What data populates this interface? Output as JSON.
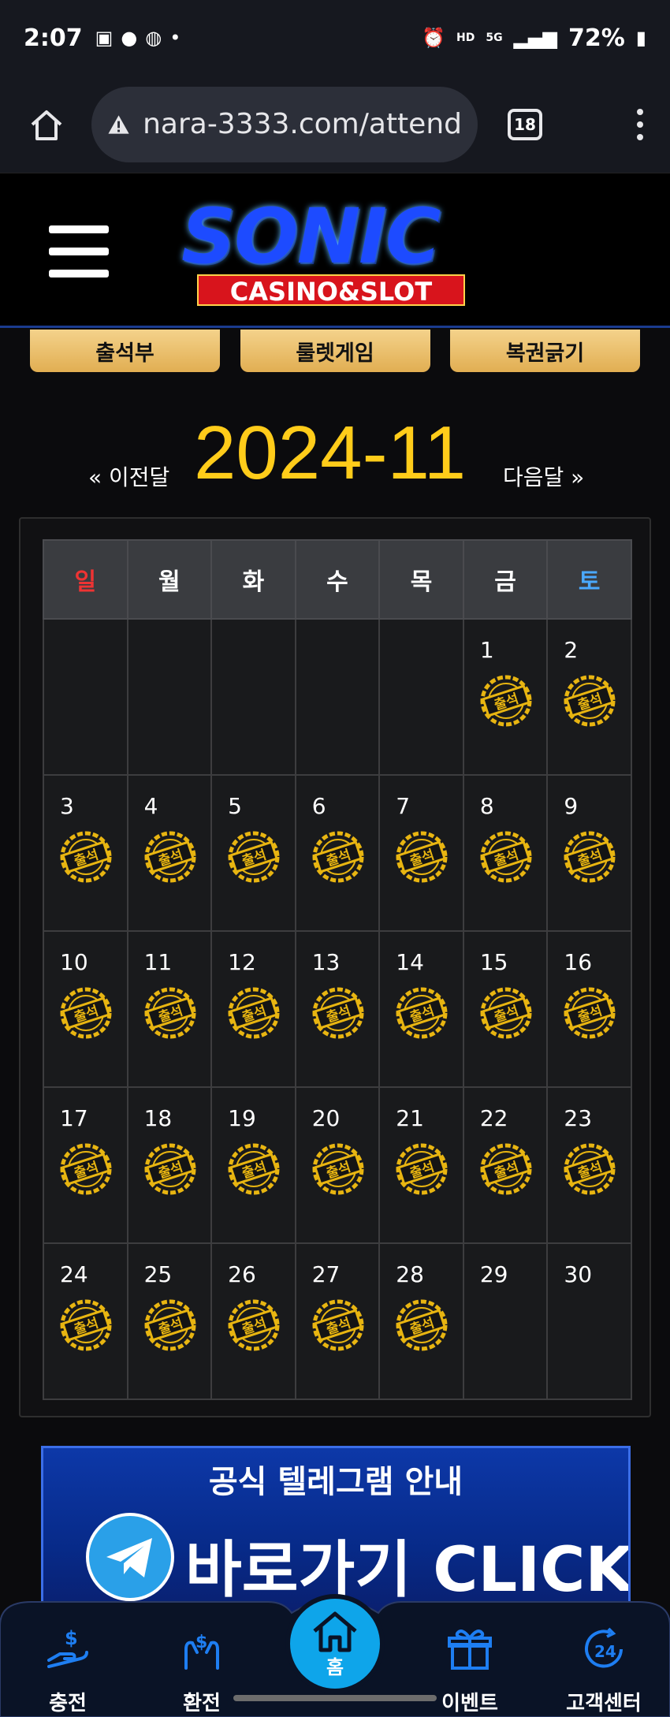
{
  "status": {
    "time": "2:07",
    "notif_icons": [
      "image-icon",
      "talk-icon",
      "chat-icon",
      "dot-icon"
    ],
    "right_icons": [
      "alarm-icon",
      "hd-voice-icon",
      "5g-icon",
      "signal-icon"
    ],
    "battery": "72%"
  },
  "browser": {
    "url": "nara-3333.com/attend",
    "tab_count": "18"
  },
  "site": {
    "logo_main": "SONIC",
    "logo_sub": "CASINO&SLOT",
    "tabs": [
      "출석부",
      "룰렛게임",
      "복권긁기"
    ]
  },
  "calendar": {
    "prev_label": "« 이전달",
    "next_label": "다음달 »",
    "month": "2024-11",
    "weekdays": [
      "일",
      "월",
      "화",
      "수",
      "목",
      "금",
      "토"
    ],
    "stamp_text": "출석",
    "weeks": [
      [
        null,
        null,
        null,
        null,
        null,
        {
          "day": "1",
          "attended": true
        },
        {
          "day": "2",
          "attended": true
        }
      ],
      [
        {
          "day": "3",
          "attended": true
        },
        {
          "day": "4",
          "attended": true
        },
        {
          "day": "5",
          "attended": true
        },
        {
          "day": "6",
          "attended": true
        },
        {
          "day": "7",
          "attended": true
        },
        {
          "day": "8",
          "attended": true
        },
        {
          "day": "9",
          "attended": true
        }
      ],
      [
        {
          "day": "10",
          "attended": true
        },
        {
          "day": "11",
          "attended": true
        },
        {
          "day": "12",
          "attended": true
        },
        {
          "day": "13",
          "attended": true
        },
        {
          "day": "14",
          "attended": true
        },
        {
          "day": "15",
          "attended": true
        },
        {
          "day": "16",
          "attended": true
        }
      ],
      [
        {
          "day": "17",
          "attended": true
        },
        {
          "day": "18",
          "attended": true
        },
        {
          "day": "19",
          "attended": true
        },
        {
          "day": "20",
          "attended": true
        },
        {
          "day": "21",
          "attended": true
        },
        {
          "day": "22",
          "attended": true
        },
        {
          "day": "23",
          "attended": true
        }
      ],
      [
        {
          "day": "24",
          "attended": true
        },
        {
          "day": "25",
          "attended": true
        },
        {
          "day": "26",
          "attended": true
        },
        {
          "day": "27",
          "attended": true
        },
        {
          "day": "28",
          "attended": true
        },
        {
          "day": "29",
          "attended": false
        },
        {
          "day": "30",
          "attended": false
        }
      ]
    ]
  },
  "banner": {
    "title": "공식 텔레그램 안내",
    "cta": "바로가기 CLICK"
  },
  "bottom_nav": {
    "items": [
      "충전",
      "환전",
      "홈",
      "이벤트",
      "고객센터"
    ]
  },
  "colors": {
    "accent_gold": "#ffcc1a",
    "tab_gold": "#e1ae52",
    "home_blue": "#0ea5ea",
    "sunday_red": "#ee3333",
    "saturday_blue": "#4aa9ff"
  }
}
